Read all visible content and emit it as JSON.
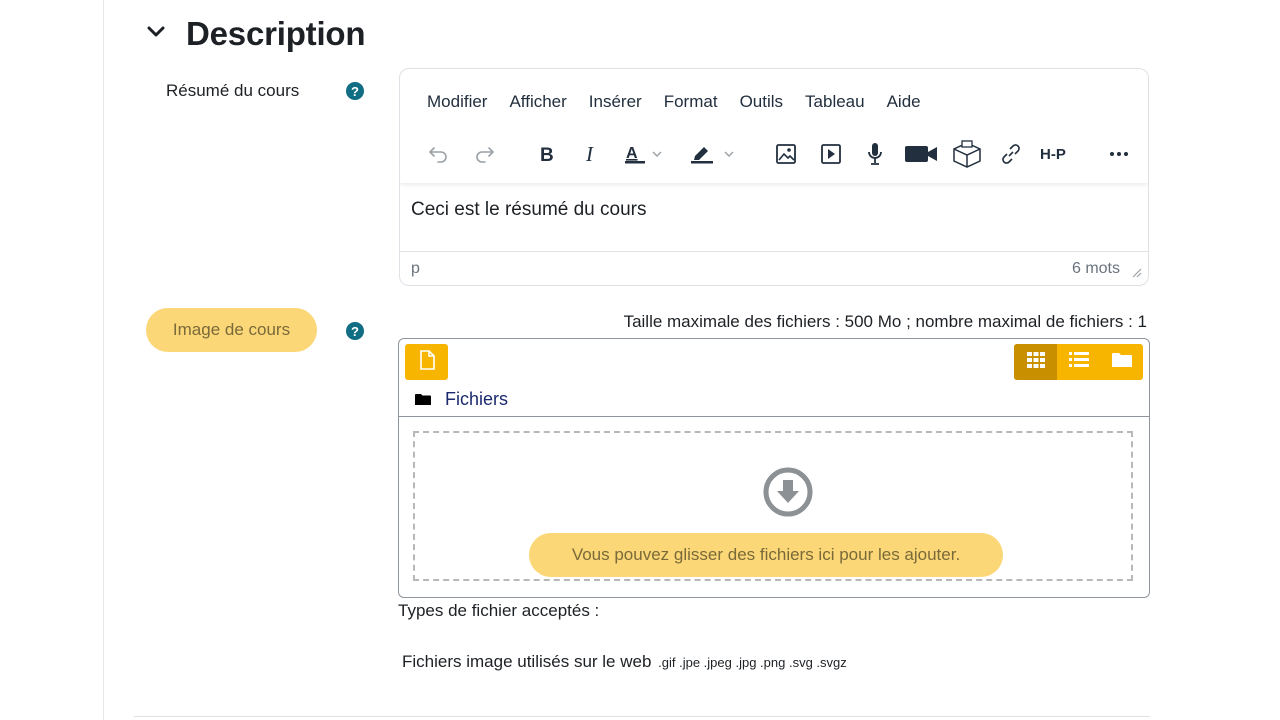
{
  "section": {
    "title": "Description"
  },
  "summary": {
    "label": "Résumé du cours",
    "help": "?",
    "menus": [
      "Modifier",
      "Afficher",
      "Insérer",
      "Format",
      "Outils",
      "Tableau",
      "Aide"
    ],
    "content": "Ceci est le résumé du cours",
    "status_path": "p",
    "word_count": "6 mots",
    "h5p_label": "H-P"
  },
  "image": {
    "label": "Image de cours",
    "help": "?",
    "limits": "Taille maximale des fichiers : 500 Mo ; nombre maximal de fichiers : 1",
    "path_label": "Fichiers",
    "drop_text": "Vous pouvez glisser des fichiers ici pour les ajouter.",
    "types_title": "Types de fichier acceptés :",
    "types_group": "Fichiers image utilisés sur le web",
    "types_ext": ".gif .jpe .jpeg .jpg .png .svg .svgz"
  },
  "colors": {
    "accent": "#f7b500",
    "accent_dark": "#c88f00",
    "highlight": "#fbd777",
    "help": "#0f6e84"
  }
}
